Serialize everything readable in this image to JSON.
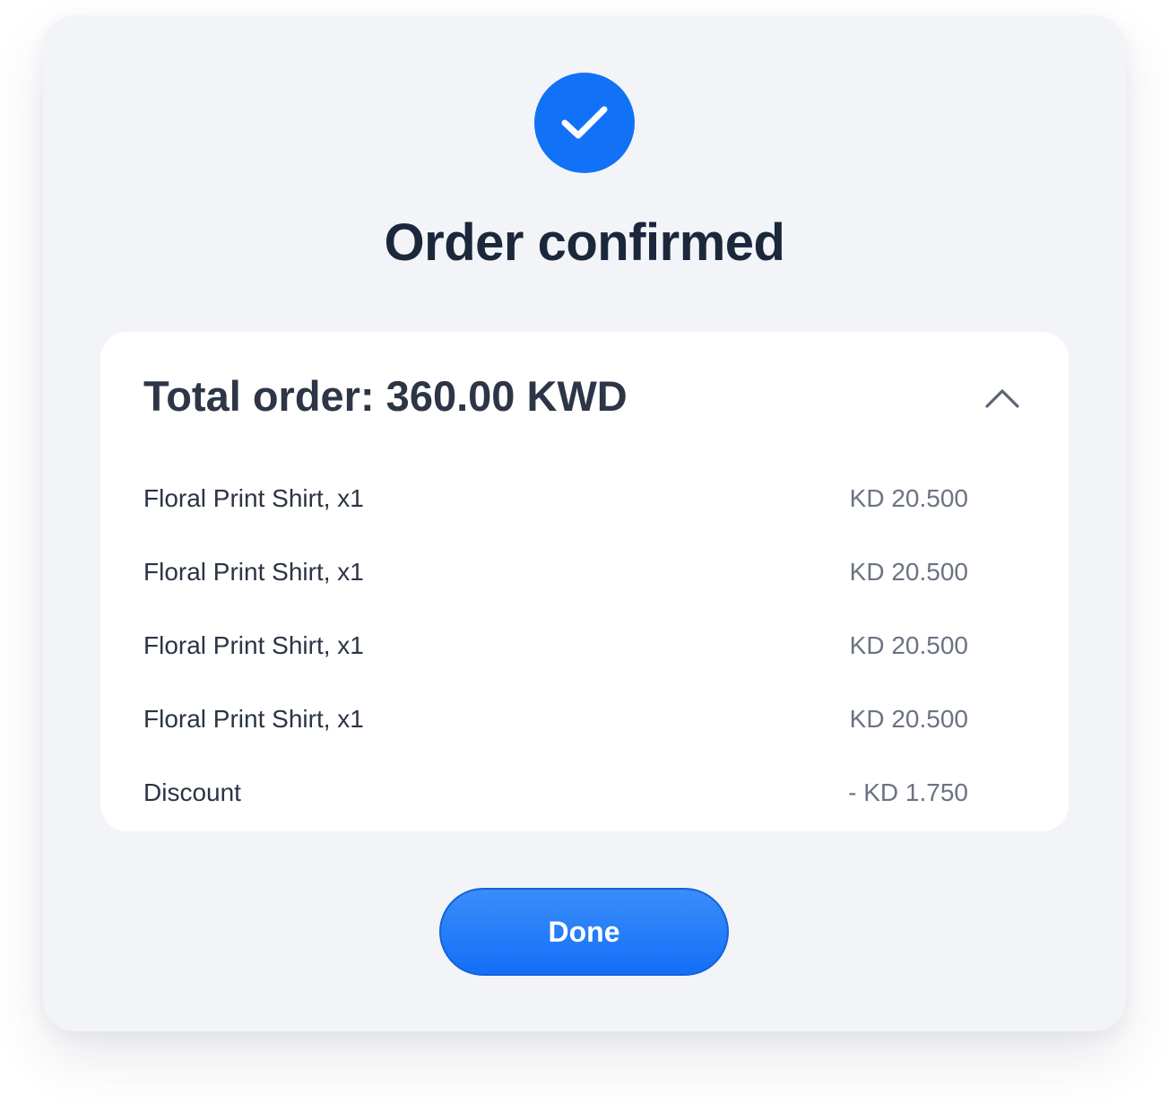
{
  "modal": {
    "title": "Order confirmed",
    "icon": "checkmark-icon",
    "accent_color": "#1272f7"
  },
  "summary": {
    "header": "Total order: 360.00 KWD",
    "toggle_icon": "chevron-up-icon",
    "items": [
      {
        "name": "Floral Print Shirt, x1",
        "price": "KD 20.500"
      },
      {
        "name": "Floral Print Shirt, x1",
        "price": "KD 20.500"
      },
      {
        "name": "Floral Print Shirt, x1",
        "price": "KD 20.500"
      },
      {
        "name": "Floral Print Shirt, x1",
        "price": "KD 20.500"
      },
      {
        "name": "Discount",
        "price": "- KD 1.750"
      }
    ]
  },
  "actions": {
    "done_label": "Done"
  }
}
